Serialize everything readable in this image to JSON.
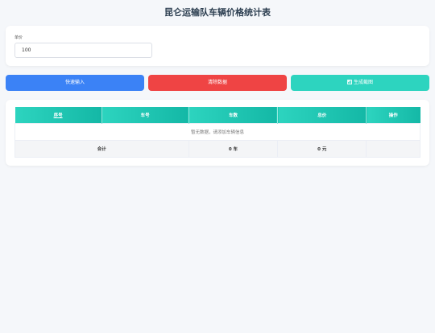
{
  "page": {
    "title": "昆仑运输队车辆价格统计表"
  },
  "price": {
    "label": "单价",
    "value": "100"
  },
  "buttons": {
    "quick_input": "快速输入",
    "clear_data": "清除数据",
    "screenshot_icon": "bar-chart-icon",
    "screenshot": "生成截图"
  },
  "colors": {
    "blue": "#3b82f6",
    "red": "#ef4444",
    "teal": "#2dd4bf",
    "header_teal": "#14b8a6"
  },
  "table": {
    "headers": [
      "序号",
      "车号",
      "车数",
      "总价",
      "操作"
    ],
    "empty_message": "暂无数据，请添加车辆信息",
    "total": {
      "label": "合计",
      "count": "0 车",
      "amount": "0 元"
    }
  }
}
